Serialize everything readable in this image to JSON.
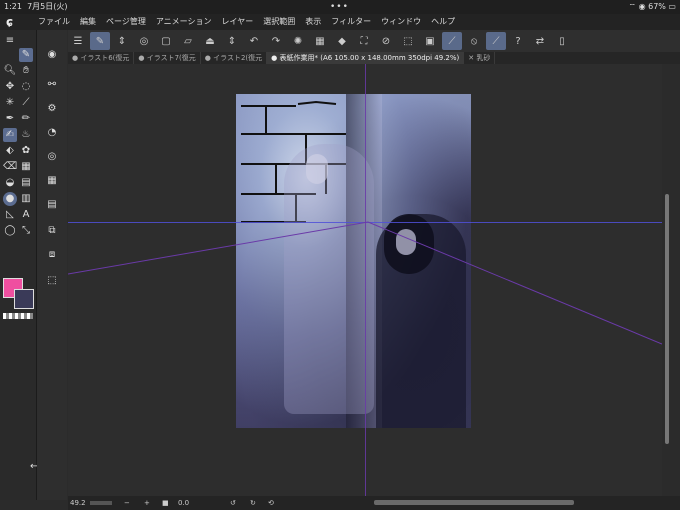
{
  "status": {
    "time": "1:21",
    "date": "7月5日(火)",
    "dots": "•••",
    "battery": "67%"
  },
  "menu": {
    "items": [
      "ファイル",
      "編集",
      "ページ管理",
      "アニメーション",
      "レイヤー",
      "選択範囲",
      "表示",
      "フィルター",
      "ウィンドウ",
      "ヘルプ"
    ]
  },
  "tabs": [
    {
      "label": "● イラスト6(復元"
    },
    {
      "label": "● イラスト7(復元"
    },
    {
      "label": "● イラスト2(復元"
    },
    {
      "label": "● 表紙作業用* (A6 105.00 x 148.00mm 350dpi 49.2%)"
    },
    {
      "label": "✕ 乳砂"
    }
  ],
  "bottom": {
    "zoom": "49.2",
    "minus": "−",
    "plus": "+",
    "angle": "0.0"
  },
  "colors": {
    "main": "#ef4fa0",
    "sub": "#3a3a58",
    "accent": "#5a6a8a"
  },
  "icons": {
    "app": "clip-studio-logo"
  }
}
